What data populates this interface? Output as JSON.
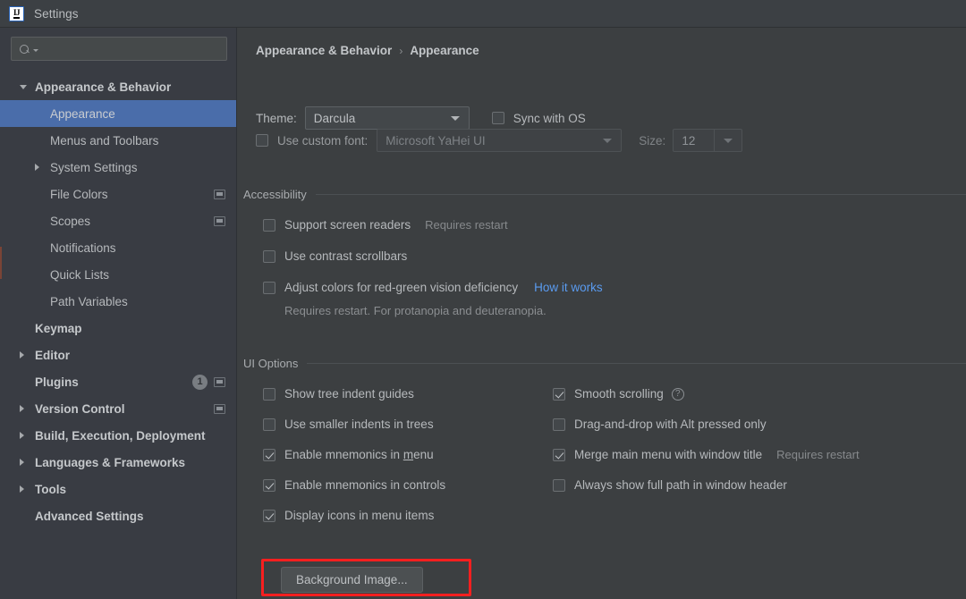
{
  "window": {
    "title": "Settings",
    "logo_icon": "intellij-idea-logo-icon"
  },
  "colors": {
    "accent_selection": "#4a6daa",
    "link": "#5a9bf0",
    "annotation": "#f81f1f",
    "panel_bg": "#3c3f41",
    "sidebar_bg": "#393c43"
  },
  "sidebar": {
    "search": {
      "value": "",
      "placeholder": "",
      "icon": "search-icon"
    },
    "items": [
      {
        "label": "Appearance & Behavior",
        "level": 0,
        "bold": true,
        "arrow": "open",
        "selected": false,
        "badge": null,
        "project_icon": false
      },
      {
        "label": "Appearance",
        "level": 1,
        "bold": false,
        "arrow": "none",
        "selected": true,
        "badge": null,
        "project_icon": false
      },
      {
        "label": "Menus and Toolbars",
        "level": 1,
        "bold": false,
        "arrow": "none",
        "selected": false,
        "badge": null,
        "project_icon": false
      },
      {
        "label": "System Settings",
        "level": 1,
        "bold": false,
        "arrow": "closed",
        "selected": false,
        "badge": null,
        "project_icon": false
      },
      {
        "label": "File Colors",
        "level": 1,
        "bold": false,
        "arrow": "none",
        "selected": false,
        "badge": null,
        "project_icon": true
      },
      {
        "label": "Scopes",
        "level": 1,
        "bold": false,
        "arrow": "none",
        "selected": false,
        "badge": null,
        "project_icon": true
      },
      {
        "label": "Notifications",
        "level": 1,
        "bold": false,
        "arrow": "none",
        "selected": false,
        "badge": null,
        "project_icon": false
      },
      {
        "label": "Quick Lists",
        "level": 1,
        "bold": false,
        "arrow": "none",
        "selected": false,
        "badge": null,
        "project_icon": false
      },
      {
        "label": "Path Variables",
        "level": 1,
        "bold": false,
        "arrow": "none",
        "selected": false,
        "badge": null,
        "project_icon": false
      },
      {
        "label": "Keymap",
        "level": 0,
        "bold": true,
        "arrow": "none",
        "selected": false,
        "badge": null,
        "project_icon": false
      },
      {
        "label": "Editor",
        "level": 0,
        "bold": true,
        "arrow": "closed",
        "selected": false,
        "badge": null,
        "project_icon": false
      },
      {
        "label": "Plugins",
        "level": 0,
        "bold": true,
        "arrow": "none",
        "selected": false,
        "badge": "1",
        "project_icon": true
      },
      {
        "label": "Version Control",
        "level": 0,
        "bold": true,
        "arrow": "closed",
        "selected": false,
        "badge": null,
        "project_icon": true
      },
      {
        "label": "Build, Execution, Deployment",
        "level": 0,
        "bold": true,
        "arrow": "closed",
        "selected": false,
        "badge": null,
        "project_icon": false
      },
      {
        "label": "Languages & Frameworks",
        "level": 0,
        "bold": true,
        "arrow": "closed",
        "selected": false,
        "badge": null,
        "project_icon": false
      },
      {
        "label": "Tools",
        "level": 0,
        "bold": true,
        "arrow": "closed",
        "selected": false,
        "badge": null,
        "project_icon": false
      },
      {
        "label": "Advanced Settings",
        "level": 0,
        "bold": true,
        "arrow": "none",
        "selected": false,
        "badge": null,
        "project_icon": false
      }
    ]
  },
  "main": {
    "breadcrumb": {
      "root": "Appearance & Behavior",
      "separator": "›",
      "current": "Appearance"
    },
    "theme_row": {
      "label": "Theme:",
      "value": "Darcula",
      "sync_checkbox": {
        "label": "Sync with OS",
        "checked": false
      }
    },
    "font_row": {
      "checkbox": {
        "label": "Use custom font:",
        "checked": false
      },
      "font_value": "Microsoft YaHei UI",
      "size_label": "Size:",
      "size_value": "12"
    },
    "accessibility": {
      "title": "Accessibility",
      "options": [
        {
          "label": "Support screen readers",
          "checked": false,
          "hint": "Requires restart",
          "link": null
        },
        {
          "label": "Use contrast scrollbars",
          "checked": false,
          "hint": null,
          "link": null
        },
        {
          "label": "Adjust colors for red-green vision deficiency",
          "checked": false,
          "hint": null,
          "link": "How it works"
        }
      ],
      "note": "Requires restart. For protanopia and deuteranopia."
    },
    "ui_options": {
      "title": "UI Options",
      "left_column": [
        {
          "label": "Show tree indent guides",
          "checked": false,
          "mnemonic": null
        },
        {
          "label": "Use smaller indents in trees",
          "checked": false,
          "mnemonic": null
        },
        {
          "label": "Enable mnemonics in menu",
          "checked": true,
          "mnemonic": "m"
        },
        {
          "label": "Enable mnemonics in controls",
          "checked": true,
          "mnemonic": null
        },
        {
          "label": "Display icons in menu items",
          "checked": true,
          "mnemonic": null
        }
      ],
      "right_column": [
        {
          "label": "Smooth scrolling",
          "checked": true,
          "help_icon": "help-icon",
          "hint": null
        },
        {
          "label": "Drag-and-drop with Alt pressed only",
          "checked": false,
          "help_icon": null,
          "hint": null
        },
        {
          "label": "Merge main menu with window title",
          "checked": true,
          "help_icon": null,
          "hint": "Requires restart"
        },
        {
          "label": "Always show full path in window header",
          "checked": false,
          "help_icon": null,
          "hint": null
        }
      ],
      "background_image_button": "Background Image..."
    }
  }
}
